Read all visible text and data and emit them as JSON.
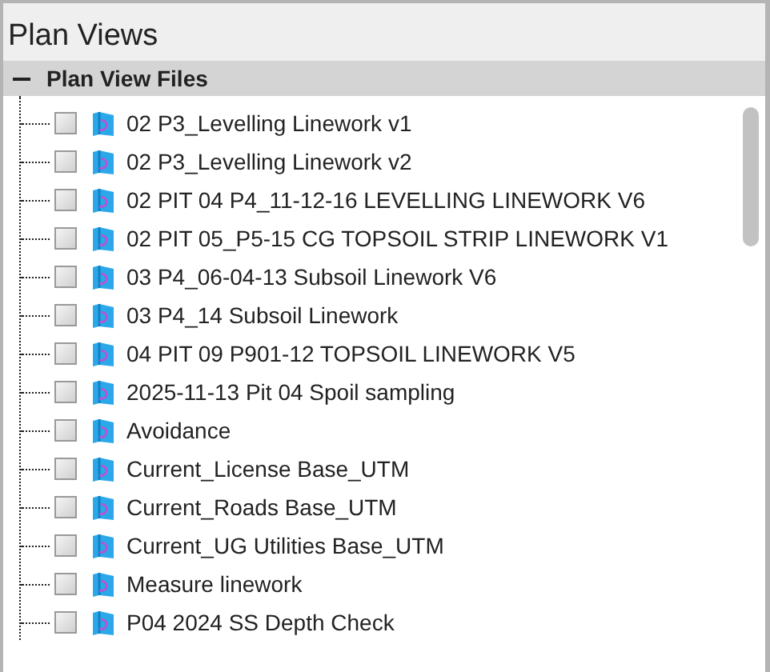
{
  "panel": {
    "title": "Plan Views"
  },
  "section": {
    "label": "Plan View Files",
    "expanded": true
  },
  "files": [
    {
      "name": "02 P3_Levelling Linework v1",
      "checked": false
    },
    {
      "name": "02 P3_Levelling Linework v2",
      "checked": false
    },
    {
      "name": "02 PIT 04 P4_11-12-16 LEVELLING LINEWORK V6",
      "checked": false
    },
    {
      "name": "02 PIT 05_P5-15 CG TOPSOIL STRIP LINEWORK V1",
      "checked": false
    },
    {
      "name": "03 P4_06-04-13 Subsoil Linework V6",
      "checked": false
    },
    {
      "name": "03 P4_14 Subsoil Linework",
      "checked": false
    },
    {
      "name": "04 PIT 09 P901-12 TOPSOIL LINEWORK V5",
      "checked": false
    },
    {
      "name": "2025-11-13 Pit 04 Spoil sampling",
      "checked": false
    },
    {
      "name": "Avoidance",
      "checked": false
    },
    {
      "name": "Current_License Base_UTM",
      "checked": false
    },
    {
      "name": "Current_Roads Base_UTM",
      "checked": false
    },
    {
      "name": "Current_UG Utilities Base_UTM",
      "checked": false
    },
    {
      "name": "Measure linework",
      "checked": false
    },
    {
      "name": "P04 2024 SS Depth Check",
      "checked": false
    }
  ]
}
